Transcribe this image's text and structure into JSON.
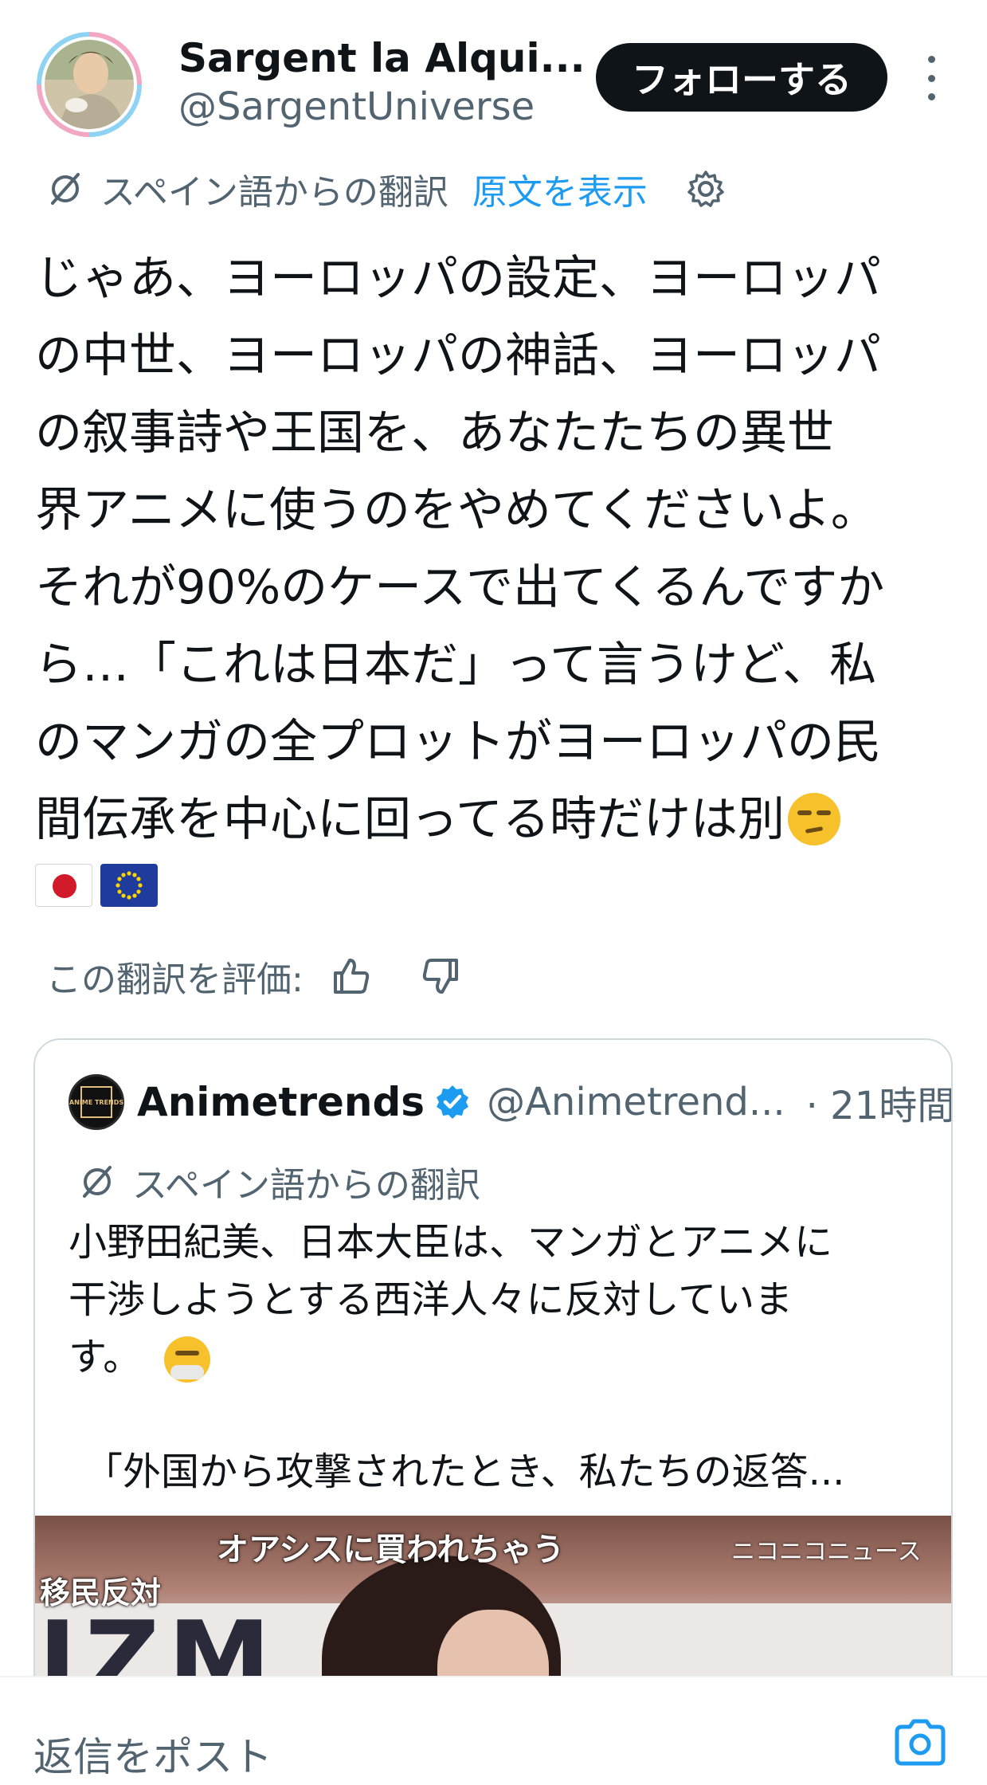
{
  "post": {
    "author": {
      "display_name": "Sargent la Alqui...",
      "handle": "@SargentUniverse"
    },
    "follow_label": "フォローする",
    "translation_label": "スペイン語からの翻訳",
    "show_original_label": "原文を表示",
    "body_lines": [
      "じゃあ、ヨーロッパの設定、ヨーロッパ",
      "の中世、ヨーロッパの神話、ヨーロッパ",
      "の叙事詩や王国を、あなたたちの異世",
      "界アニメに使うのをやめてくださいよ。",
      "それが90%のケースで出てくるんですか",
      "ら…「これは日本だ」って言うけど、私",
      "のマンガの全プロットがヨーロッパの民",
      "間伝承を中心に回ってる時だけは別"
    ],
    "rate_label": "この翻訳を評価:"
  },
  "quote": {
    "avatar_text": "ANIME TRENDS",
    "display_name": "Animetrends",
    "handle": "@Animetrend...",
    "time": "· 21時間",
    "translation_label": "スペイン語からの翻訳",
    "body_lines": [
      "小野田紀美、日本大臣は、マンガとアニメに",
      "干渉しようとする西洋人々に反対していま",
      "す。"
    ],
    "body_tail": "「外国から攻撃されたとき、私たちの返答...",
    "image": {
      "caption_top": "オアシスに買われちゃう",
      "caption_left": "移民反対",
      "watermark": "ニコニコニュース",
      "banner_text": "IZM"
    }
  },
  "reply": {
    "placeholder": "返信をポスト"
  },
  "icons": {
    "translate": "translate-icon",
    "settings": "gear-icon",
    "thumbs_up": "thumbs-up-icon",
    "thumbs_down": "thumbs-down-icon",
    "verified": "verified-badge-icon",
    "camera": "camera-icon",
    "more": "more-vertical-icon"
  },
  "colors": {
    "link": "#1d9bf0",
    "secondary_text": "#536471",
    "follow_button": "#0f1419",
    "verified": "#1d9bf0"
  }
}
